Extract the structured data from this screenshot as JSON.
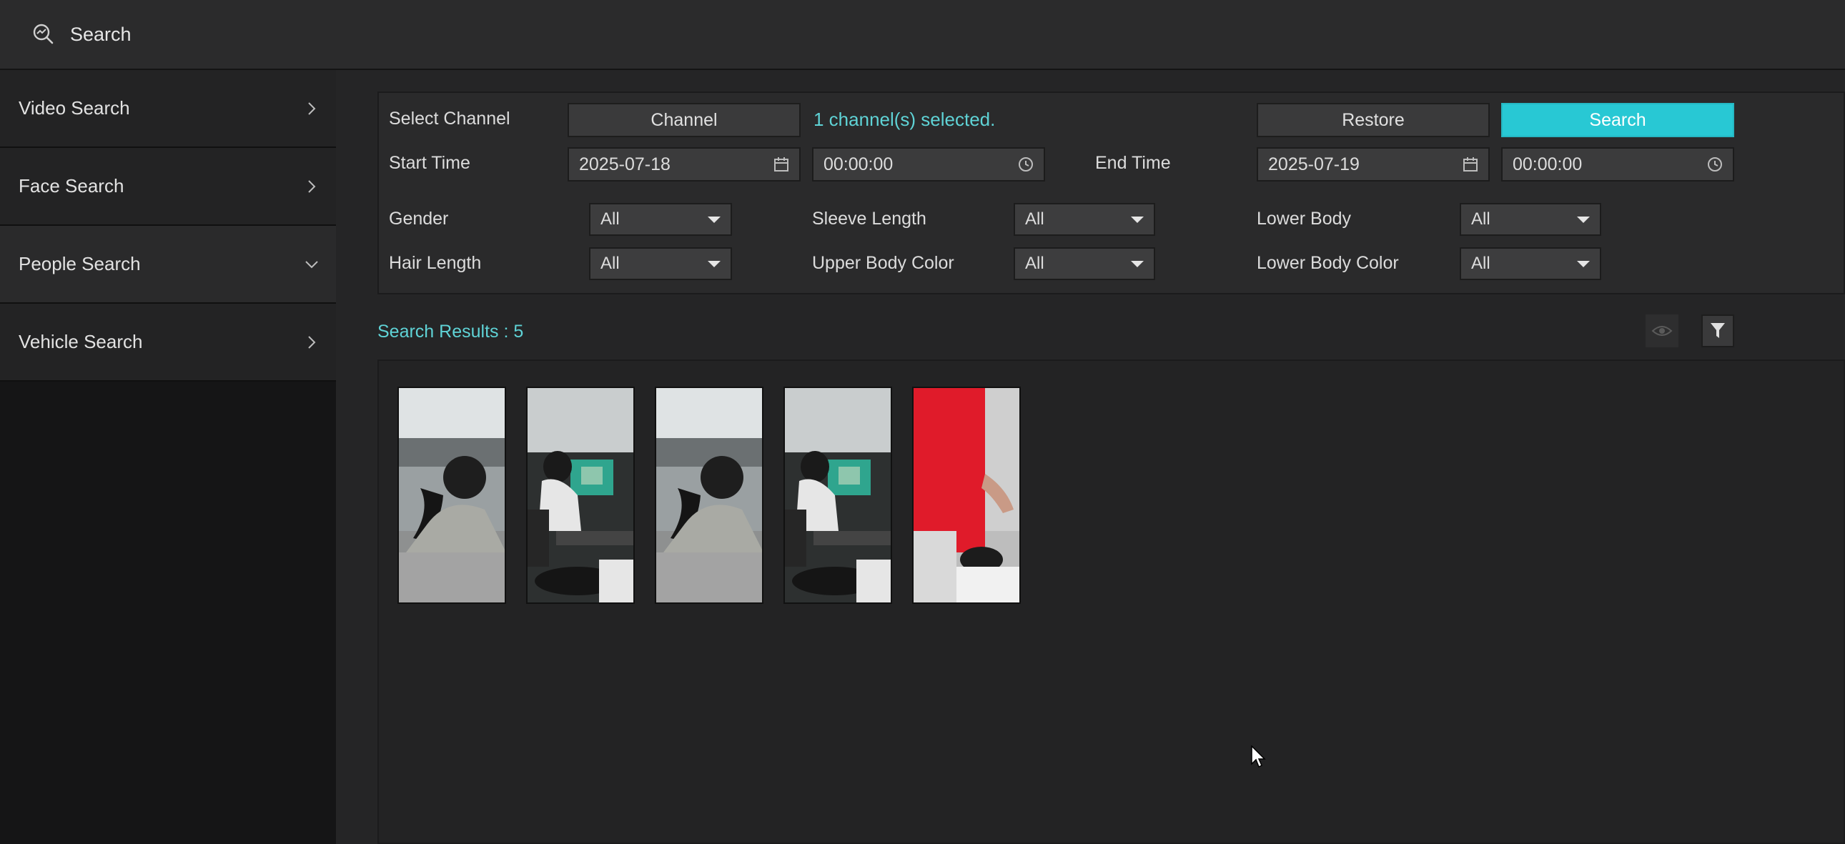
{
  "header": {
    "title": "Search",
    "icon": "search-analytics-icon"
  },
  "sidebar": {
    "items": [
      {
        "label": "Video Search",
        "chevron": "right"
      },
      {
        "label": "Face Search",
        "chevron": "right"
      },
      {
        "label": "People Search",
        "chevron": "down"
      },
      {
        "label": "Vehicle Search",
        "chevron": "right"
      }
    ]
  },
  "filters": {
    "select_channel_label": "Select Channel",
    "channel_button": "Channel",
    "channel_selected_text": "1 channel(s) selected.",
    "restore_button": "Restore",
    "search_button": "Search",
    "start_time_label": "Start Time",
    "start_date": "2025-07-18",
    "start_time": "00:00:00",
    "end_time_label": "End Time",
    "end_date": "2025-07-19",
    "end_time": "00:00:00",
    "gender_label": "Gender",
    "gender_value": "All",
    "sleeve_length_label": "Sleeve Length",
    "sleeve_length_value": "All",
    "lower_body_label": "Lower Body",
    "lower_body_value": "All",
    "hair_length_label": "Hair Length",
    "hair_length_value": "All",
    "upper_body_color_label": "Upper Body Color",
    "upper_body_color_value": "All",
    "lower_body_color_label": "Lower Body Color",
    "lower_body_color_value": "All"
  },
  "results": {
    "label": "Search Results : 5",
    "thumbnails": [
      "person-crop-1",
      "person-crop-2",
      "person-crop-3",
      "person-crop-4",
      "person-crop-5"
    ]
  },
  "colors": {
    "accent": "#28c8d4",
    "accent_text": "#5fd3d6"
  }
}
